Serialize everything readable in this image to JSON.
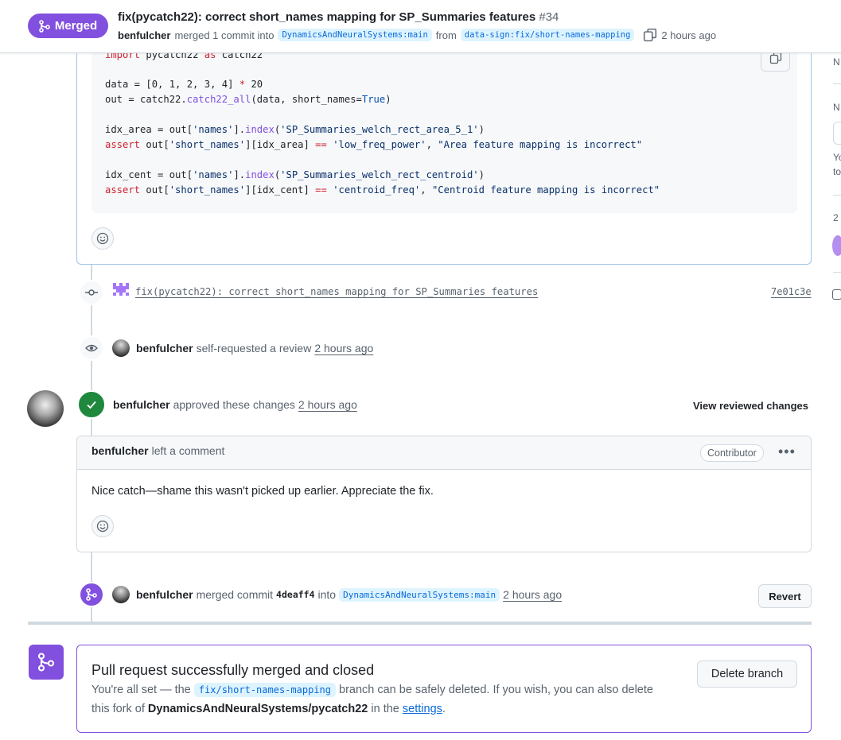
{
  "header": {
    "status": "Merged",
    "title": "fix(pycatch22): correct short_names mapping for SP_Summaries features",
    "number": "#34",
    "author": "benfulcher",
    "action": "merged 1 commit into",
    "base_branch": "DynamicsAndNeuralSystems:main",
    "from_word": "from",
    "head_branch": "data-sign:fix/short-names-mapping",
    "time": "2 hours ago"
  },
  "sidebar_fragments": [
    "N",
    "N",
    "Yo",
    "to",
    "2"
  ],
  "code": {
    "lines": [
      {
        "t": "import pycatch22 as catch22"
      },
      {
        "t": "data = [0, 1, 2, 3, 4] * 20"
      },
      {
        "t": "out = catch22.catch22_all(data, short_names=True)"
      },
      {
        "t": "idx_area = out['names'].index('SP_Summaries_welch_rect_area_5_1')"
      },
      {
        "t": "assert out['short_names'][idx_area] == 'low_freq_power', \"Area feature mapping is incorrect\""
      },
      {
        "t": "idx_cent = out['names'].index('SP_Summaries_welch_rect_centroid')"
      },
      {
        "t": "assert out['short_names'][idx_cent] == 'centroid_freq', \"Centroid feature mapping is incorrect\""
      }
    ]
  },
  "timeline": {
    "commit": {
      "message": "fix(pycatch22): correct short_names mapping for SP_Summaries features",
      "sha": "7e01c3e"
    },
    "review_request": {
      "user": "benfulcher",
      "action": "self-requested a review",
      "time": "2 hours ago"
    },
    "approval": {
      "user": "benfulcher",
      "action": "approved these changes",
      "time": "2 hours ago",
      "view_label": "View reviewed changes"
    },
    "comment": {
      "user": "benfulcher",
      "action": "left a comment",
      "badge": "Contributor",
      "body": "Nice catch—shame this wasn't picked up earlier. Appreciate the fix."
    },
    "merge_event": {
      "user": "benfulcher",
      "action": "merged commit",
      "sha": "4deaff4",
      "into_word": "into",
      "branch": "DynamicsAndNeuralSystems:main",
      "time": "2 hours ago",
      "revert_label": "Revert"
    }
  },
  "merge_box": {
    "title": "Pull request successfully merged and closed",
    "line1_pre": "You're all set — the",
    "branch": "fix/short-names-mapping",
    "line1_post": "branch can be safely deleted. If you wish, you can also delete",
    "line2_pre": "this fork of",
    "repo": "DynamicsAndNeuralSystems/pycatch22",
    "line2_mid": "in the",
    "settings_link": "settings",
    "line2_end": ".",
    "delete_label": "Delete branch"
  },
  "colors": {
    "merged_purple": "#8250df",
    "approved_green": "#1f883d",
    "link_blue": "#0969da",
    "border": "#d1d9e0"
  }
}
